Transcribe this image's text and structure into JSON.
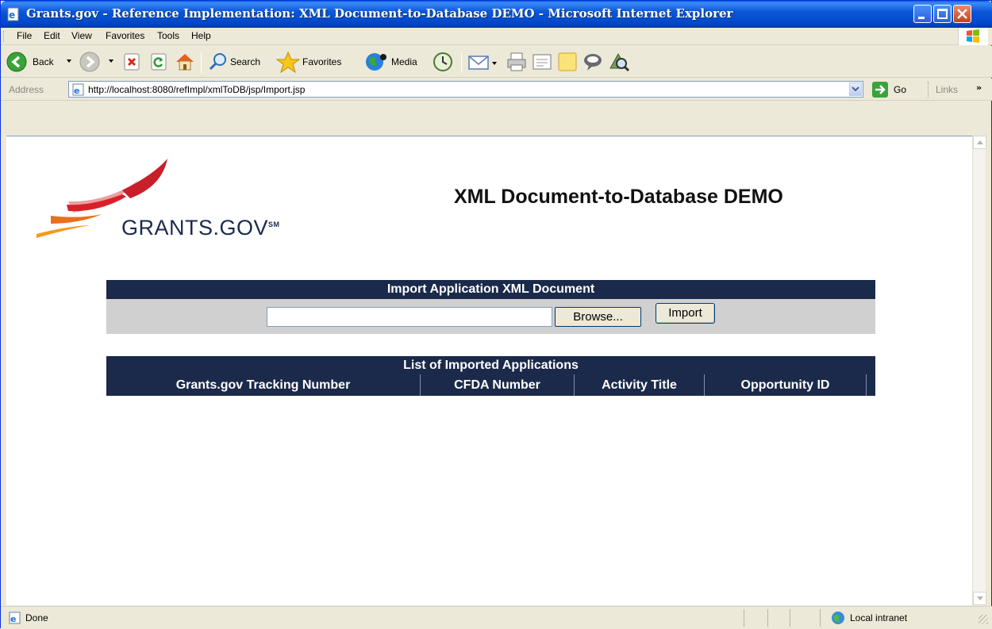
{
  "window": {
    "title": "Grants.gov - Reference Implementation: XML Document-to-Database DEMO - Microsoft Internet Explorer"
  },
  "menu": {
    "items": [
      "File",
      "Edit",
      "View",
      "Favorites",
      "Tools",
      "Help"
    ]
  },
  "toolbar": {
    "back_label": "Back",
    "search_label": "Search",
    "favorites_label": "Favorites",
    "media_label": "Media"
  },
  "address": {
    "label": "Address",
    "url": "http://localhost:8080/refImpl/xmlToDB/jsp/Import.jsp",
    "go_label": "Go",
    "links_label": "Links"
  },
  "page": {
    "logo_text": "GRANTS.GOV",
    "logo_mark": "SM",
    "title": "XML Document-to-Database DEMO",
    "import_panel": {
      "heading": "Import Application XML Document",
      "file_value": "",
      "browse_label": "Browse...",
      "import_label": "Import"
    },
    "list_panel": {
      "heading": "List of Imported Applications",
      "columns": [
        "Grants.gov Tracking Number",
        "CFDA Number",
        "Activity Title",
        "Opportunity ID"
      ]
    }
  },
  "status": {
    "text": "Done",
    "zone": "Local intranet"
  },
  "colors": {
    "navy_header": "#1b2a4a",
    "panel_gray": "#d0d0d0",
    "titlebar_blue": "#0a57d8"
  }
}
